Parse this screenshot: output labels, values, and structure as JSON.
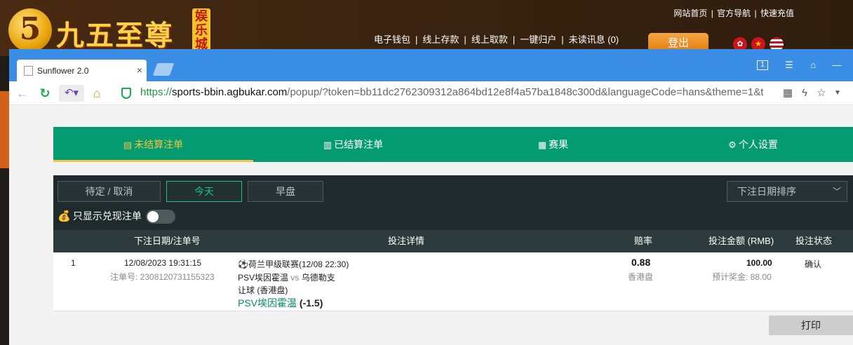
{
  "site": {
    "logo_char": "5",
    "logo_text": "九五至尊",
    "logo_badge": "娱乐城",
    "top_links": [
      "网站首页",
      "官方导航",
      "快速充值"
    ],
    "nav_links": [
      "电子钱包",
      "线上存款",
      "线上取款",
      "一键归户",
      "未读讯息 (0)"
    ],
    "login_label": "登出"
  },
  "browser": {
    "tab_title": "Sunflower 2.0",
    "tab_close": "×",
    "url_scheme": "https://",
    "url_host": "sports-bbin.agbukar.com",
    "url_path": "/popup/?token=bb11dc2762309312a864bd12e8f4a57ba1848c300d&languageCode=hans&theme=1&t",
    "window_controls": [
      "1",
      "☰",
      "⌂",
      "—"
    ]
  },
  "app": {
    "tabs": [
      {
        "icon": "▤",
        "label": "未结算注单",
        "active": true
      },
      {
        "icon": "▥",
        "label": "已结算注单",
        "active": false
      },
      {
        "icon": "▦",
        "label": "赛果",
        "active": false
      },
      {
        "icon": "⚙",
        "label": "个人设置",
        "active": false
      }
    ],
    "filters": {
      "pending": "待定 / 取消",
      "today": "今天",
      "early": "早盘",
      "sort": "下注日期排序",
      "cashout_label": "只显示兑现注单"
    },
    "columns": {
      "date": "下注日期/注单号",
      "detail": "投注详情",
      "odds": "赔率",
      "stake": "投注金额 (RMB)",
      "status": "投注状态"
    },
    "bets": [
      {
        "index": "1",
        "date": "12/08/2023 19:31:15",
        "ticket": "注单号: 2308120731155323",
        "league": "荷兰甲级联赛(12/08 22:30)",
        "home": "PSV埃因霍温",
        "vs": "vs",
        "away": "乌德勒支",
        "market": "让球 (香港盘)",
        "selection": "PSV埃因霍温",
        "handicap": "(-1.5)",
        "odds": "0.88",
        "odds_type": "香港盘",
        "stake": "100.00",
        "payout": "预计奖金: 88.00",
        "status": "确认"
      }
    ],
    "print_label": "打印"
  }
}
